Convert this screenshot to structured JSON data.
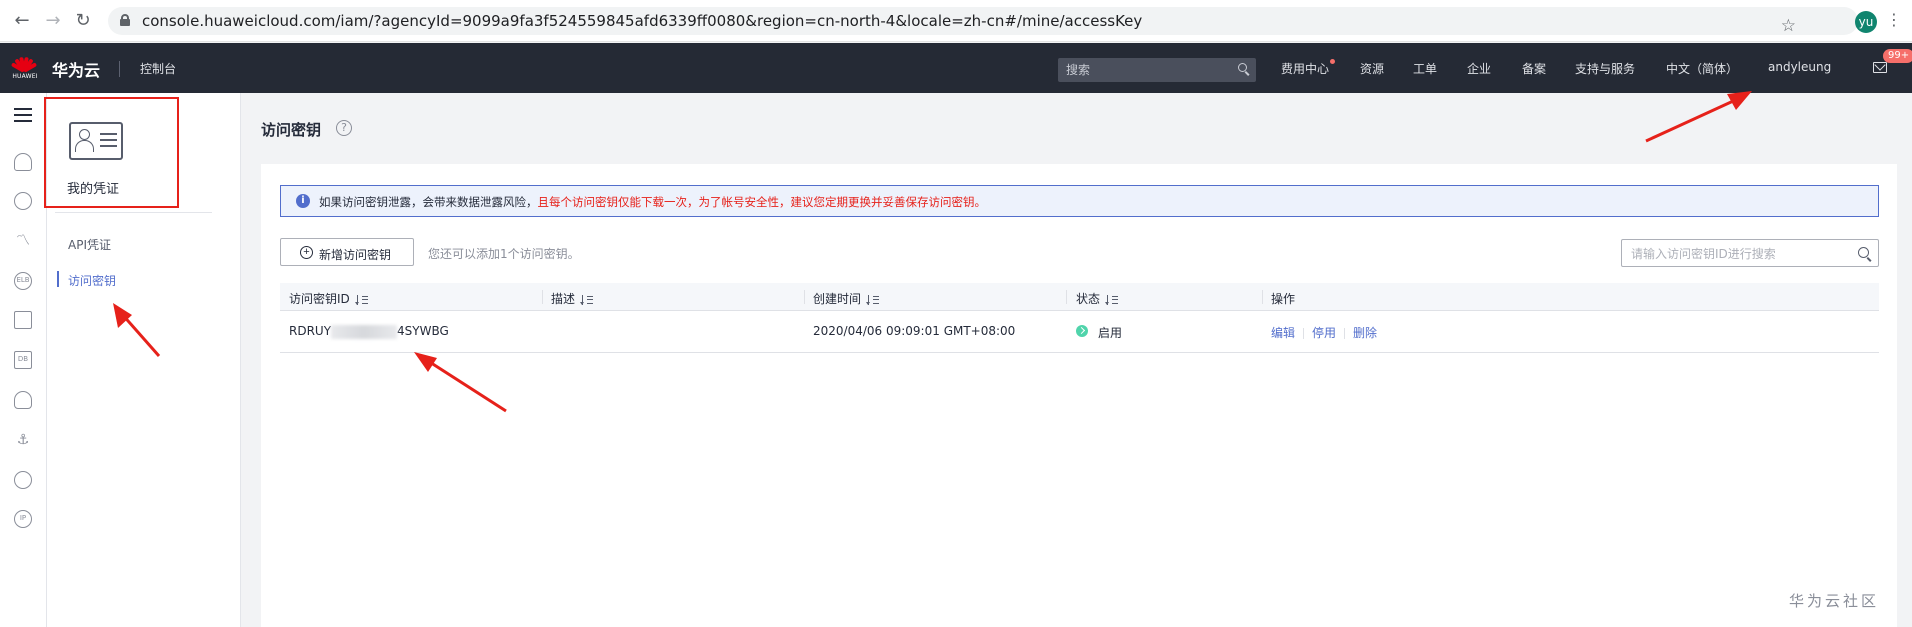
{
  "browser": {
    "url": "console.huaweicloud.com/iam/?agencyId=9099a9fa3f524559845afd6339ff0080&region=cn-north-4&locale=zh-cn#/mine/accessKey",
    "avatar_text": "yu"
  },
  "header": {
    "logo_text": "HUAWEI",
    "brand": "华为云",
    "console_label": "控制台",
    "search_placeholder": "搜索",
    "nav": [
      "费用中心",
      "资源",
      "工单",
      "企业",
      "备案",
      "支持与服务",
      "中文（简体）",
      "andyleung"
    ],
    "message_badge": "99+"
  },
  "rail": {
    "icons": [
      "menu-icon",
      "cloud-server-icon",
      "cluster-icon",
      "monitor-icon",
      "elb-icon",
      "storage-icon",
      "database-icon",
      "cloud-icon",
      "anchor-icon",
      "globe-icon",
      "ip-icon"
    ],
    "icon_texts": {
      "elb": "ELB",
      "db": "DB",
      "ip": "IP"
    }
  },
  "subnav": {
    "title": "我的凭证",
    "items": [
      {
        "label": "API凭证",
        "active": false
      },
      {
        "label": "访问密钥",
        "active": true
      }
    ]
  },
  "main": {
    "page_title": "访问密钥",
    "notice": {
      "text": "如果访问密钥泄露，会带来数据泄露风险，",
      "warning": "且每个访问密钥仅能下载一次，为了帐号安全性，建议您定期更换并妥善保存访问密钥。"
    },
    "add_button": "新增访问密钥",
    "quota_text": "您还可以添加1个访问密钥。",
    "search_placeholder": "请输入访问密钥ID进行搜索",
    "table": {
      "columns": [
        "访问密钥ID",
        "描述",
        "创建时间",
        "状态",
        "操作"
      ],
      "rows": [
        {
          "id_prefix": "RDRUY",
          "id_suffix": "4SYWBG",
          "description": "",
          "created": "2020/04/06 09:09:01 GMT+08:00",
          "status": "启用",
          "actions": [
            "编辑",
            "停用",
            "删除"
          ]
        }
      ]
    }
  },
  "watermark": "华为云社区",
  "colors": {
    "accent": "#526ecc",
    "topbar": "#252a35",
    "warning": "#e6211a",
    "status_ok": "#50d4ab",
    "annotation": "#e6211a"
  }
}
